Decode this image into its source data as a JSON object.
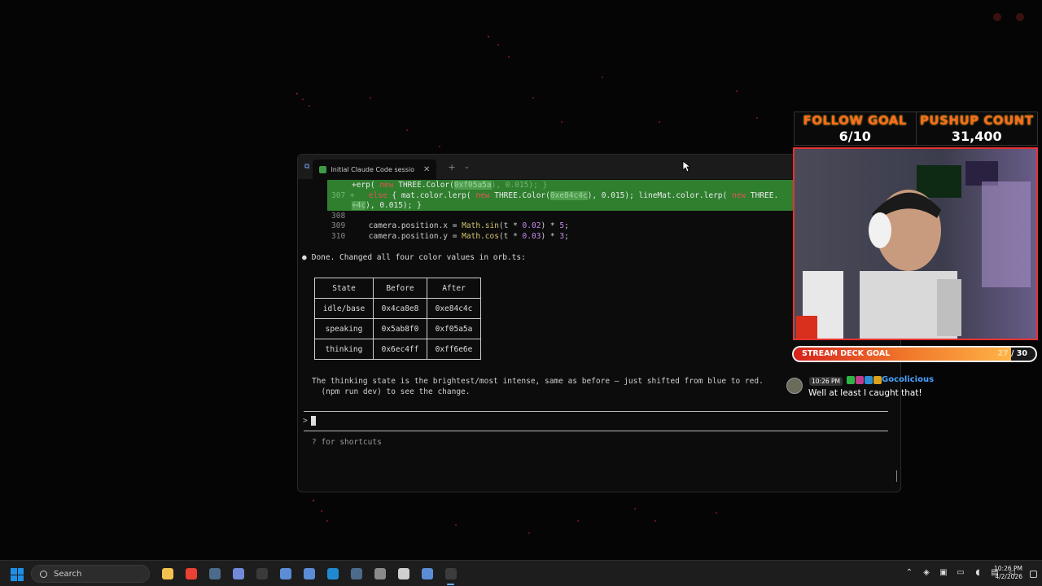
{
  "terminal": {
    "tab_title": "Initial Claude Code sessio",
    "tab_close": "✕",
    "tab_add": "+",
    "tab_dropdown": "⌄",
    "diff": {
      "line_a_pre": "+erp( ",
      "line_a_new": "new",
      "line_a_mid": " THREE.Color(",
      "line_a_hex": "0xf05a5a",
      "line_a_post": "), 0.015); }",
      "line_b_num": "307 +",
      "line_b_kw": "else",
      "line_b_mid": " { mat.color.lerp( ",
      "line_b_new": "new",
      "line_b_mid2": " THREE.Color(",
      "line_b_hex": "0xe84c4c",
      "line_b_post": "), 0.015); lineMat.color.lerp( ",
      "line_b_new2": "new",
      "line_b_end": " THREE.",
      "line_c_hex": "+4c",
      "line_c_post": "), 0.015); }"
    },
    "code": [
      {
        "num": "308",
        "text": ""
      },
      {
        "num": "309",
        "pre": "camera.position.x = ",
        "fn": "Math.sin",
        "mid": "(t * ",
        "n1": "0.02",
        "mid2": ") * ",
        "n2": "5",
        "end": ";"
      },
      {
        "num": "310",
        "pre": "camera.position.y = ",
        "fn": "Math.cos",
        "mid": "(t * ",
        "n1": "0.03",
        "mid2": ") * ",
        "n2": "3",
        "end": ";"
      }
    ],
    "done_bullet": "●",
    "done_text": "Done. Changed all four color values in orb.ts:",
    "table": {
      "headers": [
        "State",
        "Before",
        "After"
      ],
      "rows": [
        [
          "idle/base",
          "0x4ca8e8",
          "0xe84c4c"
        ],
        [
          "speaking",
          "0x5ab8f0",
          "0xf05a5a"
        ],
        [
          "thinking",
          "0x6ec4ff",
          "0xff6e6e"
        ]
      ]
    },
    "summary_line1": "The thinking state is the brightest/most intense, same as before — just shifted from blue to red.",
    "summary_line2": "(npm run dev) to see the change.",
    "prompt_symbol": ">",
    "hint": "? for shortcuts"
  },
  "overlay": {
    "follow_goal_title": "FOLLOW GOAL",
    "follow_goal_value": "6/10",
    "pushup_title": "PUSHUP COUNT",
    "pushup_value": "31,400",
    "deck_label": "STREAM DECK GOAL",
    "deck_current": "27",
    "deck_sep": " / ",
    "deck_target": "30",
    "deck_progress": 0.9,
    "chat_time": "10:26 PM",
    "chat_user": "Gocolicious",
    "chat_message": "Well at least I caught that!"
  },
  "taskbar": {
    "search_placeholder": "Search",
    "clock_time": "10:26 PM",
    "clock_date": "4/2/2026",
    "tray_chevron": "⌃",
    "apps": [
      {
        "name": "file-explorer-icon",
        "color": "#f2c14e"
      },
      {
        "name": "chrome-icon",
        "color": "#e94235"
      },
      {
        "name": "steam-icon",
        "color": "#4c6b8a"
      },
      {
        "name": "discord-icon",
        "color": "#7289da"
      },
      {
        "name": "obs-icon",
        "color": "#3a3a3a"
      },
      {
        "name": "app-diamond-icon",
        "color": "#5b8dd6"
      },
      {
        "name": "app-diamond-2-icon",
        "color": "#5b8dd6"
      },
      {
        "name": "vscode-icon",
        "color": "#1f8ad2"
      },
      {
        "name": "steam-2-icon",
        "color": "#4c6b8a"
      },
      {
        "name": "store-icon",
        "color": "#8a8a8a"
      },
      {
        "name": "mail-icon",
        "color": "#cfcfcf"
      },
      {
        "name": "app-diamond-3-icon",
        "color": "#5b8dd6"
      },
      {
        "name": "terminal-icon",
        "color": "#3c3c3c"
      }
    ]
  }
}
